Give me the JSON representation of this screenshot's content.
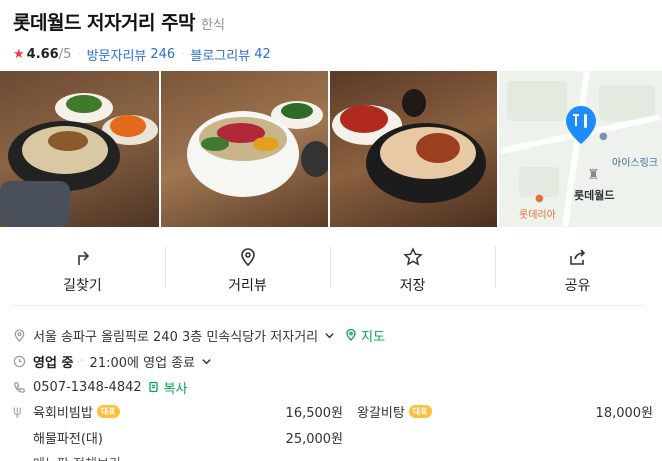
{
  "header": {
    "title": "롯데월드 저자거리 주막",
    "category": "한식",
    "rating": "4.66",
    "rating_max": "/5",
    "visitor_review_label": "방문자리뷰",
    "visitor_review_count": "246",
    "blog_review_label": "블로그리뷰",
    "blog_review_count": "42"
  },
  "map": {
    "landmark_label": "롯데월드",
    "ice_rink_label": "아이스링크",
    "lotteria_label": "롯데리아"
  },
  "actions": [
    {
      "label": "길찾기",
      "icon": "directions-icon"
    },
    {
      "label": "거리뷰",
      "icon": "location-pin-icon"
    },
    {
      "label": "저장",
      "icon": "star-icon"
    },
    {
      "label": "공유",
      "icon": "share-icon"
    }
  ],
  "info": {
    "address": "서울 송파구 올림픽로 240 3층 민속식당가 저자거리",
    "map_link": "지도",
    "status": "영업 중",
    "hours": "21:00에 영업 종료",
    "phone": "0507-1348-4842",
    "copy_label": "복사"
  },
  "menu": {
    "items": [
      {
        "name": "육회비빔밥",
        "badge": "대표",
        "price": "16,500원"
      },
      {
        "name": "왕갈비탕",
        "badge": "대표",
        "price": "18,000원"
      },
      {
        "name": "해물파전(대)",
        "badge": "",
        "price": "25,000원"
      }
    ],
    "more_label": "메뉴판 전체보기"
  },
  "colors": {
    "accent_blue": "#2d6fd6",
    "green": "#03a94d",
    "star_red": "#f03d3d",
    "badge_yellow": "#ffbe3b"
  }
}
